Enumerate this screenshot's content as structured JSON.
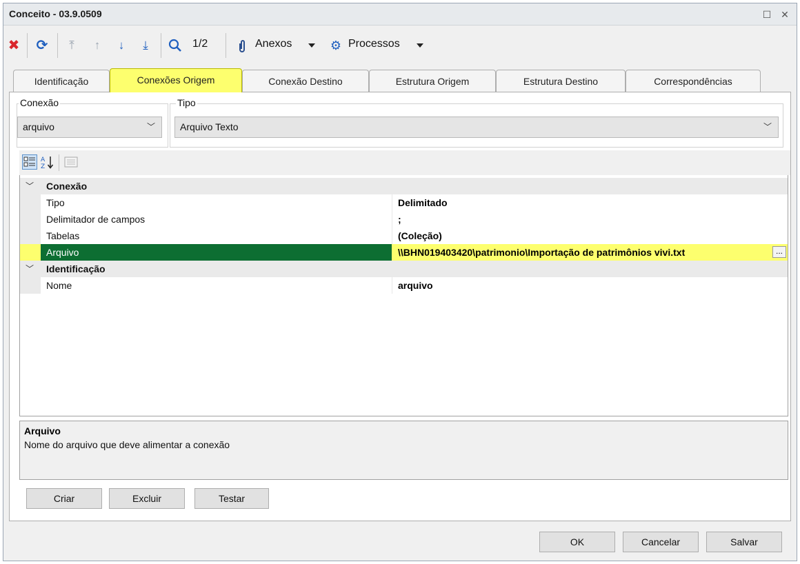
{
  "window": {
    "title": "Conceito - 03.9.0509",
    "maximize_icon": "maximize-icon",
    "close_icon": "close-icon"
  },
  "toolbar": {
    "page_indicator": "1/2",
    "anexos_label": "Anexos",
    "processos_label": "Processos",
    "colors": {
      "delete": "#d9262c",
      "nav": "#1f5fbf",
      "accent": "#0d6e32"
    }
  },
  "tabs": [
    {
      "label": "Identificação",
      "active": false
    },
    {
      "label": "Conexões Origem",
      "active": true
    },
    {
      "label": "Conexão Destino",
      "active": false
    },
    {
      "label": "Estrutura Origem",
      "active": false
    },
    {
      "label": "Estrutura Destino",
      "active": false
    },
    {
      "label": "Correspondências",
      "active": false
    }
  ],
  "conexao": {
    "legend": "Conexão",
    "value": "arquivo"
  },
  "tipo": {
    "legend": "Tipo",
    "value": "Arquivo Texto"
  },
  "property_grid": {
    "categories": [
      {
        "label": "Conexão",
        "rows": [
          {
            "name": "Tipo",
            "value": "Delimitado"
          },
          {
            "name": "Delimitador de campos",
            "value": ";"
          },
          {
            "name": "Tabelas",
            "value": "(Coleção)"
          },
          {
            "name": "Arquivo",
            "value": "\\\\BHN019403420\\patrimonio\\Importação de patrimônios vivi.txt",
            "ellipsis": "..."
          }
        ]
      },
      {
        "label": "Identificação",
        "rows": [
          {
            "name": "Nome",
            "value": "arquivo"
          }
        ]
      }
    ]
  },
  "description": {
    "title": "Arquivo",
    "text": "Nome do arquivo que deve alimentar a conexão"
  },
  "panel_buttons": {
    "criar": "Criar",
    "excluir": "Excluir",
    "testar": "Testar"
  },
  "dialog_buttons": {
    "ok": "OK",
    "cancelar": "Cancelar",
    "salvar": "Salvar"
  }
}
